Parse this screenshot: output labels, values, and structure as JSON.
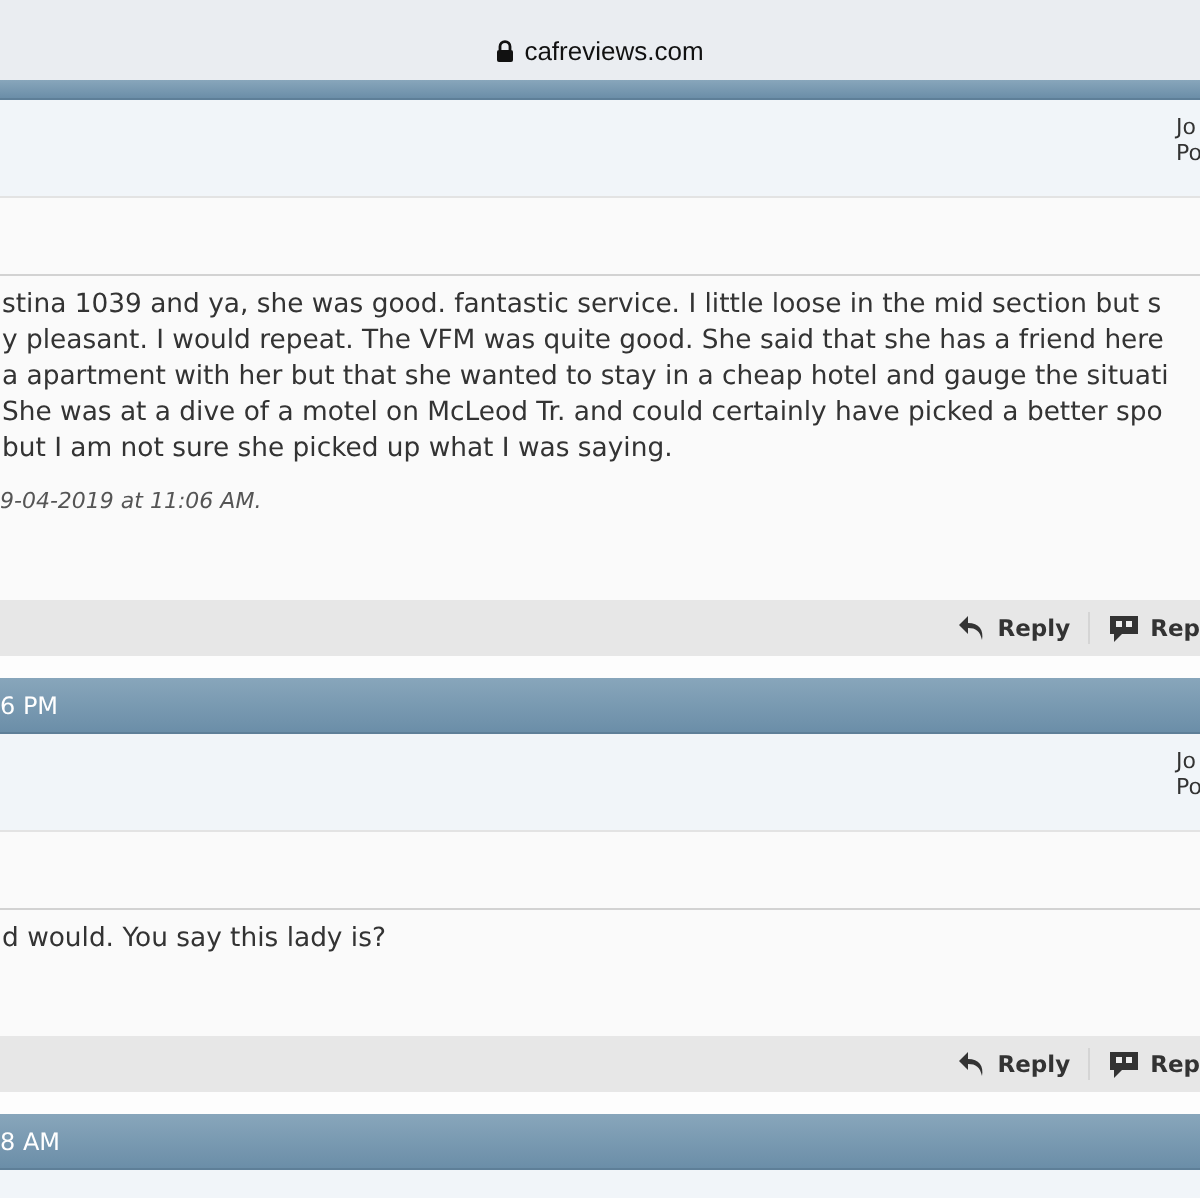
{
  "browser": {
    "address": "cafreviews.com",
    "secure": true
  },
  "posts": [
    {
      "user_info": [
        "Jo",
        "Po"
      ],
      "body": [
        "stina 1039 and ya, she was good. fantastic service. I little loose in the mid section but s",
        "y pleasant. I would repeat. The VFM was quite good. She said that she has a friend here",
        "a apartment with her but that she wanted to stay in a cheap hotel and gauge the situati",
        "She was at a dive of a motel on McLeod Tr. and could certainly have picked a better spo",
        "but I am not sure she picked up what I was saying."
      ],
      "edited": "9-04-2019 at 11:06 AM.",
      "buttons": [
        {
          "kind": "reply",
          "label": "Reply"
        },
        {
          "kind": "quote",
          "label": "Rep"
        }
      ]
    },
    {
      "header": "6 PM",
      "user_info": [
        "Jo",
        "Po"
      ],
      "body": [
        "d would. You say this lady is?"
      ],
      "buttons": [
        {
          "kind": "reply",
          "label": "Reply"
        },
        {
          "kind": "quote",
          "label": "Rep"
        }
      ]
    },
    {
      "header": "8 AM"
    }
  ]
}
